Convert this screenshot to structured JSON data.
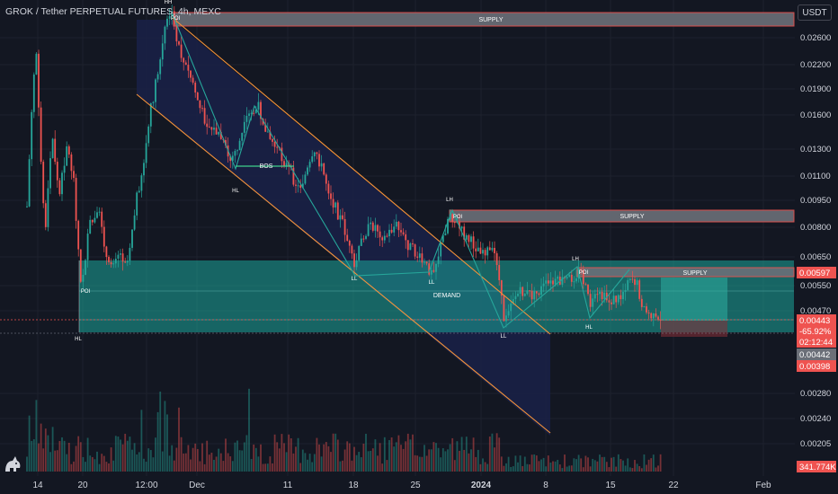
{
  "header": {
    "title": "GROK / Tether PERPETUAL FUTURES, 4h, MEXC",
    "currency": "USDT"
  },
  "colors": {
    "background": "#131722",
    "up": "#26a69a",
    "down": "#ef5350",
    "channel": "#f7943a",
    "supply": "#ef5350",
    "demand": "#1ba59b",
    "structure": "#26a69a",
    "text": "#d1d4dc"
  },
  "chart_data": {
    "type": "candlestick",
    "symbol": "GROK / Tether PERPETUAL FUTURES",
    "timeframe": "4h",
    "exchange": "MEXC",
    "y_ticks": [
      "0.02600",
      "0.02200",
      "0.01900",
      "0.01600",
      "0.01300",
      "0.01100",
      "0.00950",
      "0.00800",
      "0.00650",
      "0.00550",
      "0.00470",
      "0.00280",
      "0.00240",
      "0.00205"
    ],
    "x_ticks": [
      "14",
      "20",
      "12:00",
      "Dec",
      "11",
      "18",
      "25",
      "2024",
      "8",
      "15",
      "22",
      "Feb"
    ],
    "price_labels": [
      {
        "text": "0.00597",
        "kind": "supply"
      },
      {
        "text": "0.00443",
        "kind": "last"
      },
      {
        "text": "-65.92%",
        "kind": "last"
      },
      {
        "text": "02:12:44",
        "kind": "last"
      },
      {
        "text": "0.00442",
        "kind": "gray"
      },
      {
        "text": "0.00398",
        "kind": "down"
      },
      {
        "text": "341.774K",
        "kind": "volume"
      }
    ],
    "zones": [
      {
        "label": "SUPPLY",
        "type": "supply",
        "low": 0.0268,
        "high": 0.0282
      },
      {
        "label": "SUPPLY",
        "type": "supply",
        "low": 0.0083,
        "high": 0.0087
      },
      {
        "label": "SUPPLY",
        "type": "supply",
        "low": 0.0057,
        "high": 0.006
      },
      {
        "label": "DEMAND",
        "type": "demand",
        "low": 0.0042,
        "high": 0.0061
      }
    ],
    "annotations": [
      "HH",
      "POI",
      "HL",
      "BOS",
      "LL",
      "LH",
      "POI",
      "LL",
      "LL",
      "LH",
      "POI",
      "HL",
      "POI",
      "HL",
      "DEMAND"
    ]
  }
}
